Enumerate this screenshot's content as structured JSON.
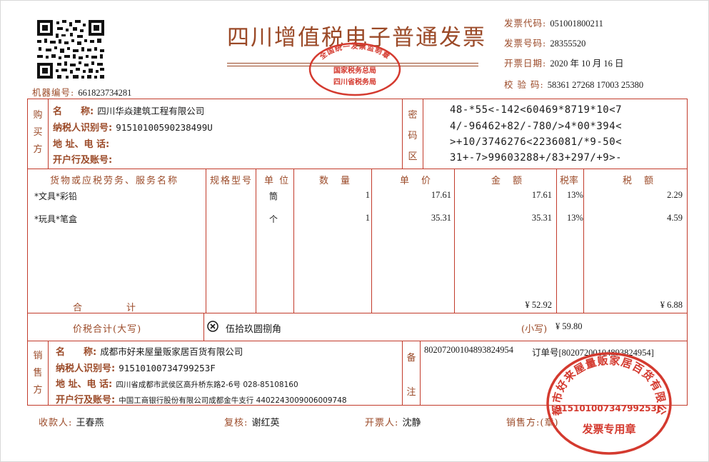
{
  "title": "四川增值税电子普通发票",
  "seal_top": {
    "arc_text": "全国统一发票监制章",
    "line1": "国家税务总局",
    "line2": "四川省税务局"
  },
  "meta": {
    "code_label": "发票代码:",
    "code": "051001800211",
    "number_label": "发票号码:",
    "number": "28355520",
    "date_label": "开票日期:",
    "date": "2020 年 10 月 16 日",
    "check_label": "校 验 码:",
    "check": "58361 27268 17003 25380",
    "machine_label": "机器编号:",
    "machine": "661823734281"
  },
  "buyer": {
    "side": [
      "购",
      "买",
      "方"
    ],
    "name_label": "名　　称:",
    "name": "四川华焱建筑工程有限公司",
    "tax_label": "纳税人识别号:",
    "tax_id": "91510100590238499U",
    "addr_label": "地 址、电 话:",
    "addr": "",
    "bank_label": "开户行及账号:",
    "bank": ""
  },
  "cipher": {
    "side": [
      "密",
      "码",
      "区"
    ],
    "lines": [
      "48-*55<-142<60469*8719*10<7",
      "4/-96462+82/-780/>4*00*394<",
      ">+10/3746276<2236081/*9-50<",
      "31+-7>99603288+/83+297/+9>-"
    ]
  },
  "table": {
    "headers": [
      "货物或应税劳务、服务名称",
      "规格型号",
      "单 位",
      "数　量",
      "单　价",
      "金　额",
      "税率",
      "税　额"
    ],
    "rows": [
      {
        "name": "*文具*彩铅",
        "spec": "",
        "unit": "筒",
        "qty": "1",
        "price": "17.61",
        "amount": "17.61",
        "rate": "13%",
        "tax": "2.29"
      },
      {
        "name": "*玩具*笔盒",
        "spec": "",
        "unit": "个",
        "qty": "1",
        "price": "35.31",
        "amount": "35.31",
        "rate": "13%",
        "tax": "4.59"
      }
    ],
    "total_label": "合　　　　计",
    "total_amount": "¥ 52.92",
    "total_tax": "¥ 6.88"
  },
  "grand_total": {
    "label": "价税合计(大写)",
    "icon": "circle-x-icon",
    "words": "伍拾玖圆捌角",
    "small_label": "(小写)",
    "small": "¥ 59.80"
  },
  "seller": {
    "side": [
      "销",
      "售",
      "方"
    ],
    "name_label": "名　　称:",
    "name": "成都市好来屋量贩家居百货有限公司",
    "tax_label": "纳税人识别号:",
    "tax_id": "91510100734799253F",
    "addr_label": "地 址、电 话:",
    "addr": "四川省成都市武侯区高升桥东路2-6号 028-85108160",
    "bank_label": "开户行及账号:",
    "bank": "中国工商银行股份有限公司成都金牛支行 4402243009006009748"
  },
  "remarks": {
    "side": [
      "备",
      "注"
    ],
    "line": "80207200104893824954",
    "order_label": "订单号",
    "order": "[80207200104893824954]"
  },
  "seal_bottom": {
    "arc_text": "成都市好来屋量贩家居百货有限公司",
    "tax_id": "91510100734799253F",
    "caption": "发票专用章"
  },
  "footer": {
    "payee_label": "收款人:",
    "payee": "王春燕",
    "reviewer_label": "复核:",
    "reviewer": "谢红英",
    "issuer_label": "开票人:",
    "issuer": "沈静",
    "seller_label": "销售方:(章)"
  },
  "colors": {
    "frame": "#c23b2b",
    "label": "#9b4a28",
    "seal": "#d43a2f"
  }
}
